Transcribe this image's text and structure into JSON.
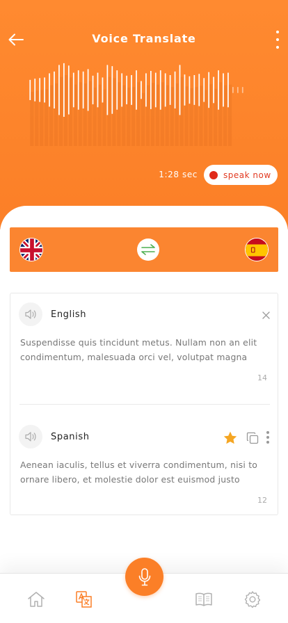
{
  "header": {
    "title": "Voice Translate",
    "timer": "1:28 sec",
    "speak_label": "speak now"
  },
  "languages": {
    "source_flag": "uk-flag-icon",
    "target_flag": "spain-flag-icon",
    "swap_icon": "swap-arrows-icon"
  },
  "source": {
    "language": "English",
    "text": "Suspendisse quis tincidunt metus. Nullam non an elit condimentum, malesuada orci vel, volutpat magna",
    "count": "14"
  },
  "target": {
    "language": "Spanish",
    "text": "Aenean iaculis, tellus et viverra condimentum, nisi to ornare libero, et molestie dolor est euismod justo",
    "count": "12"
  },
  "nav": {
    "items": [
      "home-icon",
      "translate-icon",
      "book-icon",
      "settings-icon"
    ],
    "fab": "microphone-icon"
  },
  "colors": {
    "accent": "#fb7f27",
    "record": "#e02a1a",
    "star": "#f5a623",
    "swap": "#4caf50"
  }
}
